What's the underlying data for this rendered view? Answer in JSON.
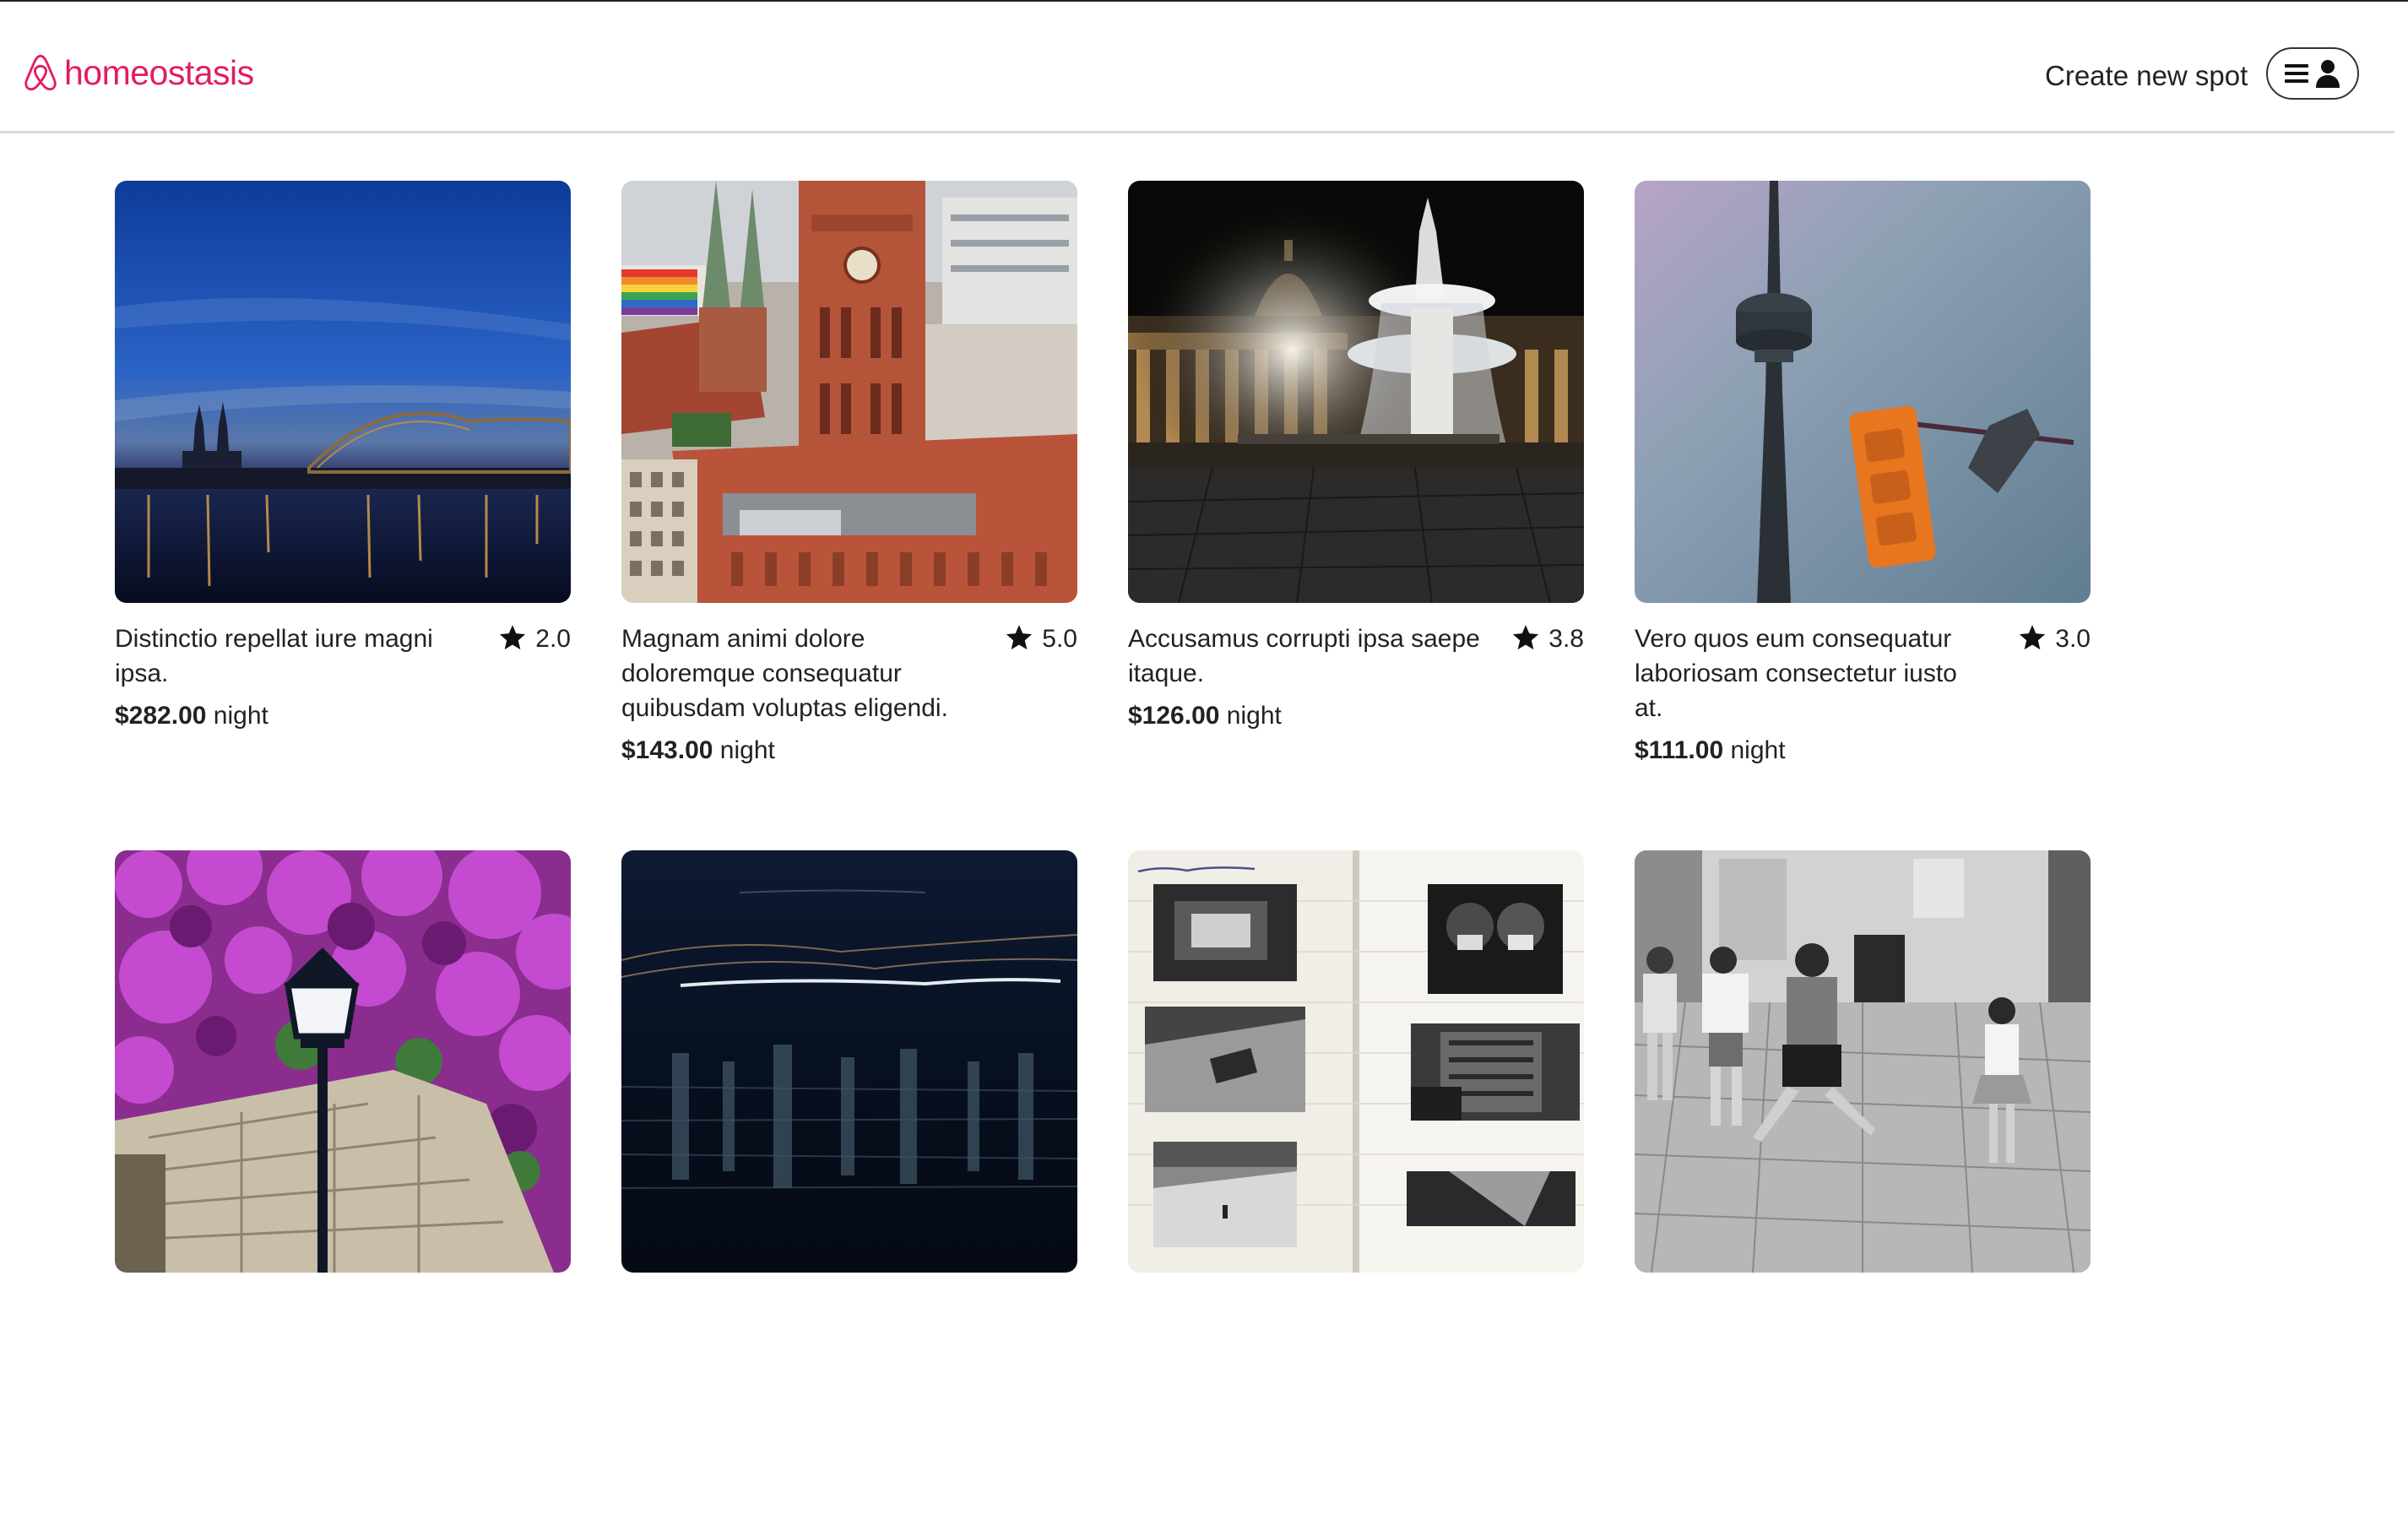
{
  "brand": {
    "name": "homeostasis",
    "logo_icon": "airbnb-style-logo-icon",
    "color": "#e31c5f"
  },
  "header": {
    "create_spot_label": "Create new spot",
    "menu_icons": [
      "hamburger-icon",
      "user-icon"
    ]
  },
  "price_suffix": "night",
  "spots": [
    {
      "name": "Distinctio repellat iure magni ipsa.",
      "rating": "2.0",
      "price": "$282.00",
      "image": "cologne-cathedral-night"
    },
    {
      "name": "Magnam animi dolore doloremque consequatur quibusdam voluptas eligendi.",
      "rating": "5.0",
      "price": "$143.00",
      "image": "berlin-red-town-hall"
    },
    {
      "name": "Accusamus corrupti ipsa saepe itaque.",
      "rating": "3.8",
      "price": "$126.00",
      "image": "st-peters-fountain-night"
    },
    {
      "name": "Vero quos eum consequatur laboriosam consectetur iusto at.",
      "rating": "3.0",
      "price": "$111.00",
      "image": "cn-tower-traffic-light"
    },
    {
      "name": "",
      "rating": "",
      "price": "",
      "image": "bougainvillea-lamp-post"
    },
    {
      "name": "",
      "rating": "",
      "price": "",
      "image": "night-water-light-trails"
    },
    {
      "name": "",
      "rating": "",
      "price": "",
      "image": "archipelago-photo-book"
    },
    {
      "name": "",
      "rating": "",
      "price": "",
      "image": "children-playing-street-bw"
    }
  ]
}
